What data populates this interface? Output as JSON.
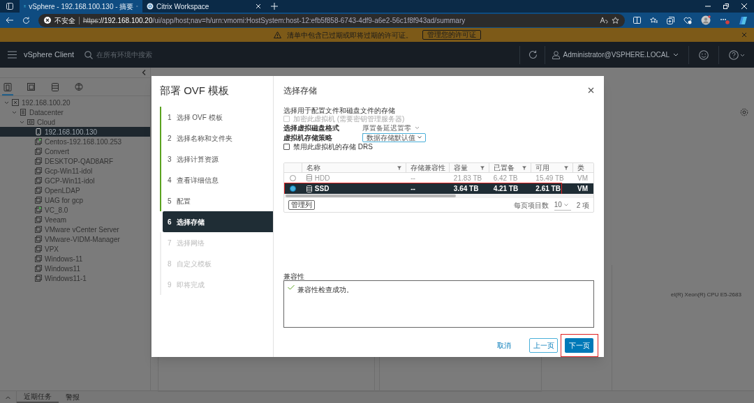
{
  "browser": {
    "tabs": [
      {
        "title": "vSphere - 192.168.100.130 - 摘要",
        "selected": true
      },
      {
        "title": "Citrix Workspace",
        "selected": false
      }
    ],
    "address": {
      "security": "不安全",
      "url_scheme": "https",
      "url_host": "://192.168.100.20",
      "url_path": "/ui/app/host;nav=h/urn:vmomi:HostSystem:host-12:efb5f858-6743-4df9-a6e2-56c1f8f943ad/summary"
    }
  },
  "banner": {
    "text": "清单中包含已过期或即将过期的许可证。",
    "button": "管理您的许可证"
  },
  "header": {
    "app_name": "vSphere Client",
    "search_placeholder": "在所有环境中搜索",
    "user": "Administrator@VSPHERE.LOCAL"
  },
  "inventory": {
    "views": [
      {
        "kind": "hosts",
        "selected": true
      },
      {
        "kind": "vms",
        "selected": false
      },
      {
        "kind": "storage",
        "selected": false
      },
      {
        "kind": "network",
        "selected": false
      }
    ],
    "tree": [
      {
        "label": "192.168.100.20",
        "kind": "vcenter",
        "expanded": true,
        "selected": false,
        "children": [
          {
            "label": "Datacenter",
            "kind": "datacenter",
            "expanded": true,
            "selected": false,
            "children": [
              {
                "label": "Cloud",
                "kind": "cluster",
                "expanded": true,
                "selected": false,
                "children": [
                  {
                    "label": "192.168.100.130",
                    "kind": "host",
                    "selected": true,
                    "powered_on": false
                  },
                  {
                    "label": "Centos-192.168.100.253",
                    "kind": "vm",
                    "selected": false,
                    "powered_on": true
                  },
                  {
                    "label": "Convert",
                    "kind": "vm",
                    "selected": false,
                    "powered_on": false
                  },
                  {
                    "label": "DESKTOP-QAD8ARF",
                    "kind": "vm",
                    "selected": false,
                    "powered_on": false
                  },
                  {
                    "label": "Gcp-Win11-idol",
                    "kind": "vm",
                    "selected": false,
                    "powered_on": false
                  },
                  {
                    "label": "GCP-Win11-idol",
                    "kind": "vm",
                    "selected": false,
                    "powered_on": false
                  },
                  {
                    "label": "OpenLDAP",
                    "kind": "vm",
                    "selected": false,
                    "powered_on": false
                  },
                  {
                    "label": "UAG for gcp",
                    "kind": "vm",
                    "selected": false,
                    "powered_on": false
                  },
                  {
                    "label": "VC_8.0",
                    "kind": "vm",
                    "selected": false,
                    "powered_on": true
                  },
                  {
                    "label": "Veeam",
                    "kind": "vm",
                    "selected": false,
                    "powered_on": false
                  },
                  {
                    "label": "VMware vCenter Server",
                    "kind": "vm",
                    "selected": false,
                    "powered_on": false
                  },
                  {
                    "label": "VMware-VIDM-Manager",
                    "kind": "vm",
                    "selected": false,
                    "powered_on": false
                  },
                  {
                    "label": "VPX",
                    "kind": "vm",
                    "selected": false,
                    "powered_on": false
                  },
                  {
                    "label": "Windows-11",
                    "kind": "vm",
                    "selected": false,
                    "powered_on": false
                  },
                  {
                    "label": "Windows11",
                    "kind": "vm",
                    "selected": false,
                    "powered_on": false
                  },
                  {
                    "label": "Windows11-1",
                    "kind": "vm",
                    "selected": false,
                    "powered_on": false
                  }
                ]
              }
            ]
          }
        ]
      }
    ]
  },
  "background": {
    "cpu_text": "el(R) Xeon(R) CPU E5-2683"
  },
  "dialog": {
    "title": "部署 OVF 模板",
    "steps": [
      {
        "number": "1",
        "label": "选择 OVF 模板",
        "completed": true,
        "selected": false
      },
      {
        "number": "2",
        "label": "选择名称和文件夹",
        "completed": true,
        "selected": false
      },
      {
        "number": "3",
        "label": "选择计算资源",
        "completed": true,
        "selected": false
      },
      {
        "number": "4",
        "label": "查看详细信息",
        "completed": true,
        "selected": false
      },
      {
        "number": "5",
        "label": "配置",
        "completed": true,
        "selected": false
      },
      {
        "number": "6",
        "label": "选择存储",
        "completed": false,
        "selected": true
      },
      {
        "number": "7",
        "label": "选择网络",
        "completed": false,
        "selected": false
      },
      {
        "number": "8",
        "label": "自定义模板",
        "completed": false,
        "selected": false
      },
      {
        "number": "9",
        "label": "即将完成",
        "completed": false,
        "selected": false
      }
    ],
    "page_title": "选择存储",
    "description": "选择用于配置文件和磁盘文件的存储",
    "encrypt": {
      "label": "加密此虚拟机 (需要密钥管理服务器)",
      "checked": false,
      "disabled": true
    },
    "disk_format": {
      "label": "选择虚拟磁盘格式",
      "value": "厚置备延迟置零"
    },
    "policy": {
      "label": "虚拟机存储策略",
      "value": "数据存储默认值"
    },
    "disable_drs": {
      "label": "禁用此虚拟机的存储 DRS",
      "checked": false,
      "disabled": false
    },
    "table": {
      "columns": [
        "名称",
        "存储兼容性",
        "容量",
        "已置备",
        "可用",
        "类"
      ],
      "rows": [
        {
          "selected": false,
          "name": "HDD",
          "compatibility": "--",
          "capacity": "21.83 TB",
          "provisioned": "6.42 TB",
          "free": "15.49 TB",
          "type": "VM"
        },
        {
          "selected": true,
          "name": "SSD",
          "compatibility": "--",
          "capacity": "3.64 TB",
          "provisioned": "4.21 TB",
          "free": "2.61 TB",
          "type": "VM"
        }
      ],
      "manage_columns": "管理列",
      "page_size_label": "每页项目数",
      "page_size": "10",
      "count": "2 项"
    },
    "compatibility": {
      "label": "兼容性",
      "message": "兼容性检查成功。"
    },
    "buttons": {
      "cancel": "取消",
      "back": "上一页",
      "next": "下一页"
    }
  },
  "bottom": {
    "tabs": [
      {
        "label": "近期任务",
        "selected": true
      },
      {
        "label": "警报",
        "selected": false
      }
    ]
  }
}
